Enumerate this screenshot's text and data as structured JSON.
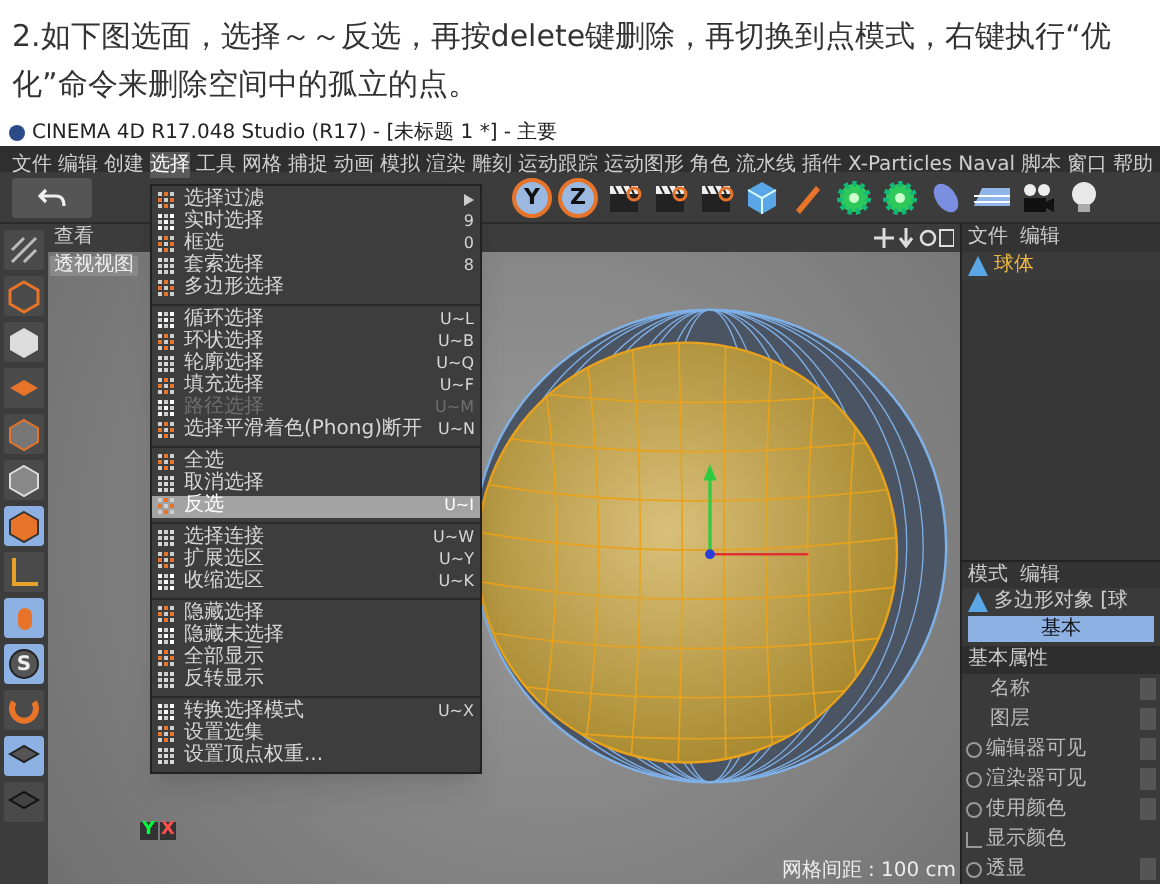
{
  "article": {
    "text": "2.如下图选面，选择～～反选，再按delete键删除，再切换到点模式，右键执行“优化”命令来删除空间中的孤立的点。"
  },
  "window": {
    "title": "CINEMA 4D R17.048 Studio (R17) - [未标题 1 *] - 主要"
  },
  "menu_bar": [
    {
      "label": "文件",
      "selected": false
    },
    {
      "label": "编辑",
      "selected": false
    },
    {
      "label": "创建",
      "selected": false
    },
    {
      "label": "选择",
      "selected": true
    },
    {
      "label": "工具",
      "selected": false
    },
    {
      "label": "网格",
      "selected": false
    },
    {
      "label": "捕捉",
      "selected": false
    },
    {
      "label": "动画",
      "selected": false
    },
    {
      "label": "模拟",
      "selected": false
    },
    {
      "label": "渲染",
      "selected": false
    },
    {
      "label": "雕刻",
      "selected": false
    },
    {
      "label": "运动跟踪",
      "selected": false
    },
    {
      "label": "运动图形",
      "selected": false
    },
    {
      "label": "角色",
      "selected": false
    },
    {
      "label": "流水线",
      "selected": false
    },
    {
      "label": "插件",
      "selected": false
    },
    {
      "label": "X-Particles",
      "selected": false
    },
    {
      "label": "Naval",
      "selected": false
    },
    {
      "label": "脚本",
      "selected": false
    },
    {
      "label": "窗口",
      "selected": false
    },
    {
      "label": "帮助",
      "selected": false
    }
  ],
  "select_menu": {
    "groups": [
      [
        {
          "label": "选择过滤",
          "kind": "submenu",
          "disabled": false,
          "selected": false
        },
        {
          "label": "实时选择",
          "shortcut": "9",
          "kind": "command",
          "disabled": false,
          "selected": false
        },
        {
          "label": "框选",
          "shortcut": "0",
          "kind": "command",
          "disabled": false,
          "selected": false
        },
        {
          "label": "套索选择",
          "shortcut": "8",
          "kind": "command",
          "disabled": false,
          "selected": false
        },
        {
          "label": "多边形选择",
          "kind": "command",
          "disabled": false,
          "selected": false
        }
      ],
      [
        {
          "label": "循环选择",
          "shortcut": "U~L",
          "kind": "command",
          "disabled": false,
          "selected": false
        },
        {
          "label": "环状选择",
          "shortcut": "U~B",
          "kind": "command",
          "disabled": false,
          "selected": false
        },
        {
          "label": "轮廓选择",
          "shortcut": "U~Q",
          "kind": "command",
          "disabled": false,
          "selected": false
        },
        {
          "label": "填充选择",
          "shortcut": "U~F",
          "kind": "command",
          "disabled": false,
          "selected": false
        },
        {
          "label": "路径选择",
          "shortcut": "U~M",
          "kind": "command",
          "disabled": true,
          "selected": false
        },
        {
          "label": "选择平滑着色(Phong)断开",
          "shortcut": "U~N",
          "kind": "command",
          "disabled": false,
          "selected": false
        }
      ],
      [
        {
          "label": "全选",
          "kind": "command",
          "disabled": false,
          "selected": false
        },
        {
          "label": "取消选择",
          "kind": "command",
          "disabled": false,
          "selected": false
        },
        {
          "label": "反选",
          "shortcut": "U~I",
          "kind": "command",
          "disabled": false,
          "selected": true
        }
      ],
      [
        {
          "label": "选择连接",
          "shortcut": "U~W",
          "kind": "command",
          "disabled": false,
          "selected": false
        },
        {
          "label": "扩展选区",
          "shortcut": "U~Y",
          "kind": "command",
          "disabled": false,
          "selected": false
        },
        {
          "label": "收缩选区",
          "shortcut": "U~K",
          "kind": "command",
          "disabled": false,
          "selected": false
        }
      ],
      [
        {
          "label": "隐藏选择",
          "kind": "command",
          "disabled": false,
          "selected": false
        },
        {
          "label": "隐藏未选择",
          "kind": "command",
          "disabled": false,
          "selected": false
        },
        {
          "label": "全部显示",
          "kind": "command",
          "disabled": false,
          "selected": false
        },
        {
          "label": "反转显示",
          "kind": "command",
          "disabled": false,
          "selected": false
        }
      ],
      [
        {
          "label": "转换选择模式",
          "shortcut": "U~X",
          "kind": "command",
          "disabled": false,
          "selected": false
        },
        {
          "label": "设置选集",
          "kind": "command",
          "disabled": false,
          "selected": false
        },
        {
          "label": "设置顶点权重...",
          "kind": "command",
          "disabled": false,
          "selected": false
        }
      ]
    ]
  },
  "toolbar": {
    "axis_buttons": [
      "Y",
      "Z"
    ]
  },
  "mode_tools": [
    {
      "selected": false
    },
    {
      "selected": false
    },
    {
      "selected": false
    },
    {
      "selected": false
    },
    {
      "selected": false
    },
    {
      "selected": false
    },
    {
      "selected": true
    },
    {
      "selected": false
    },
    {
      "selected": true
    },
    {
      "selected": true,
      "symbol": "S"
    },
    {
      "selected": false
    },
    {
      "selected": true
    },
    {
      "selected": false
    }
  ],
  "viewport": {
    "tab": "查看",
    "camera": "透视视图",
    "gizmo_labels": [
      "Y",
      "X"
    ],
    "status": "网格间距 : 100 cm"
  },
  "object_manager": {
    "tabs": [
      "文件",
      "编辑"
    ],
    "objects": [
      {
        "name": "球体",
        "selected": true
      }
    ]
  },
  "attribute_manager": {
    "tabs": [
      "模式",
      "编辑"
    ],
    "title": "多边形对象 [球",
    "sections": [
      {
        "label": "基本",
        "selected": true
      }
    ],
    "group": "基本属性",
    "rows": [
      {
        "label": "名称",
        "kind": "field"
      },
      {
        "label": "图层",
        "kind": "field"
      },
      {
        "label": "编辑器可见",
        "kind": "toggle"
      },
      {
        "label": "渲染器可见",
        "kind": "toggle"
      },
      {
        "label": "使用颜色",
        "kind": "toggle"
      },
      {
        "label": "显示颜色",
        "kind": "color"
      },
      {
        "label": "透显",
        "kind": "toggle"
      }
    ]
  }
}
